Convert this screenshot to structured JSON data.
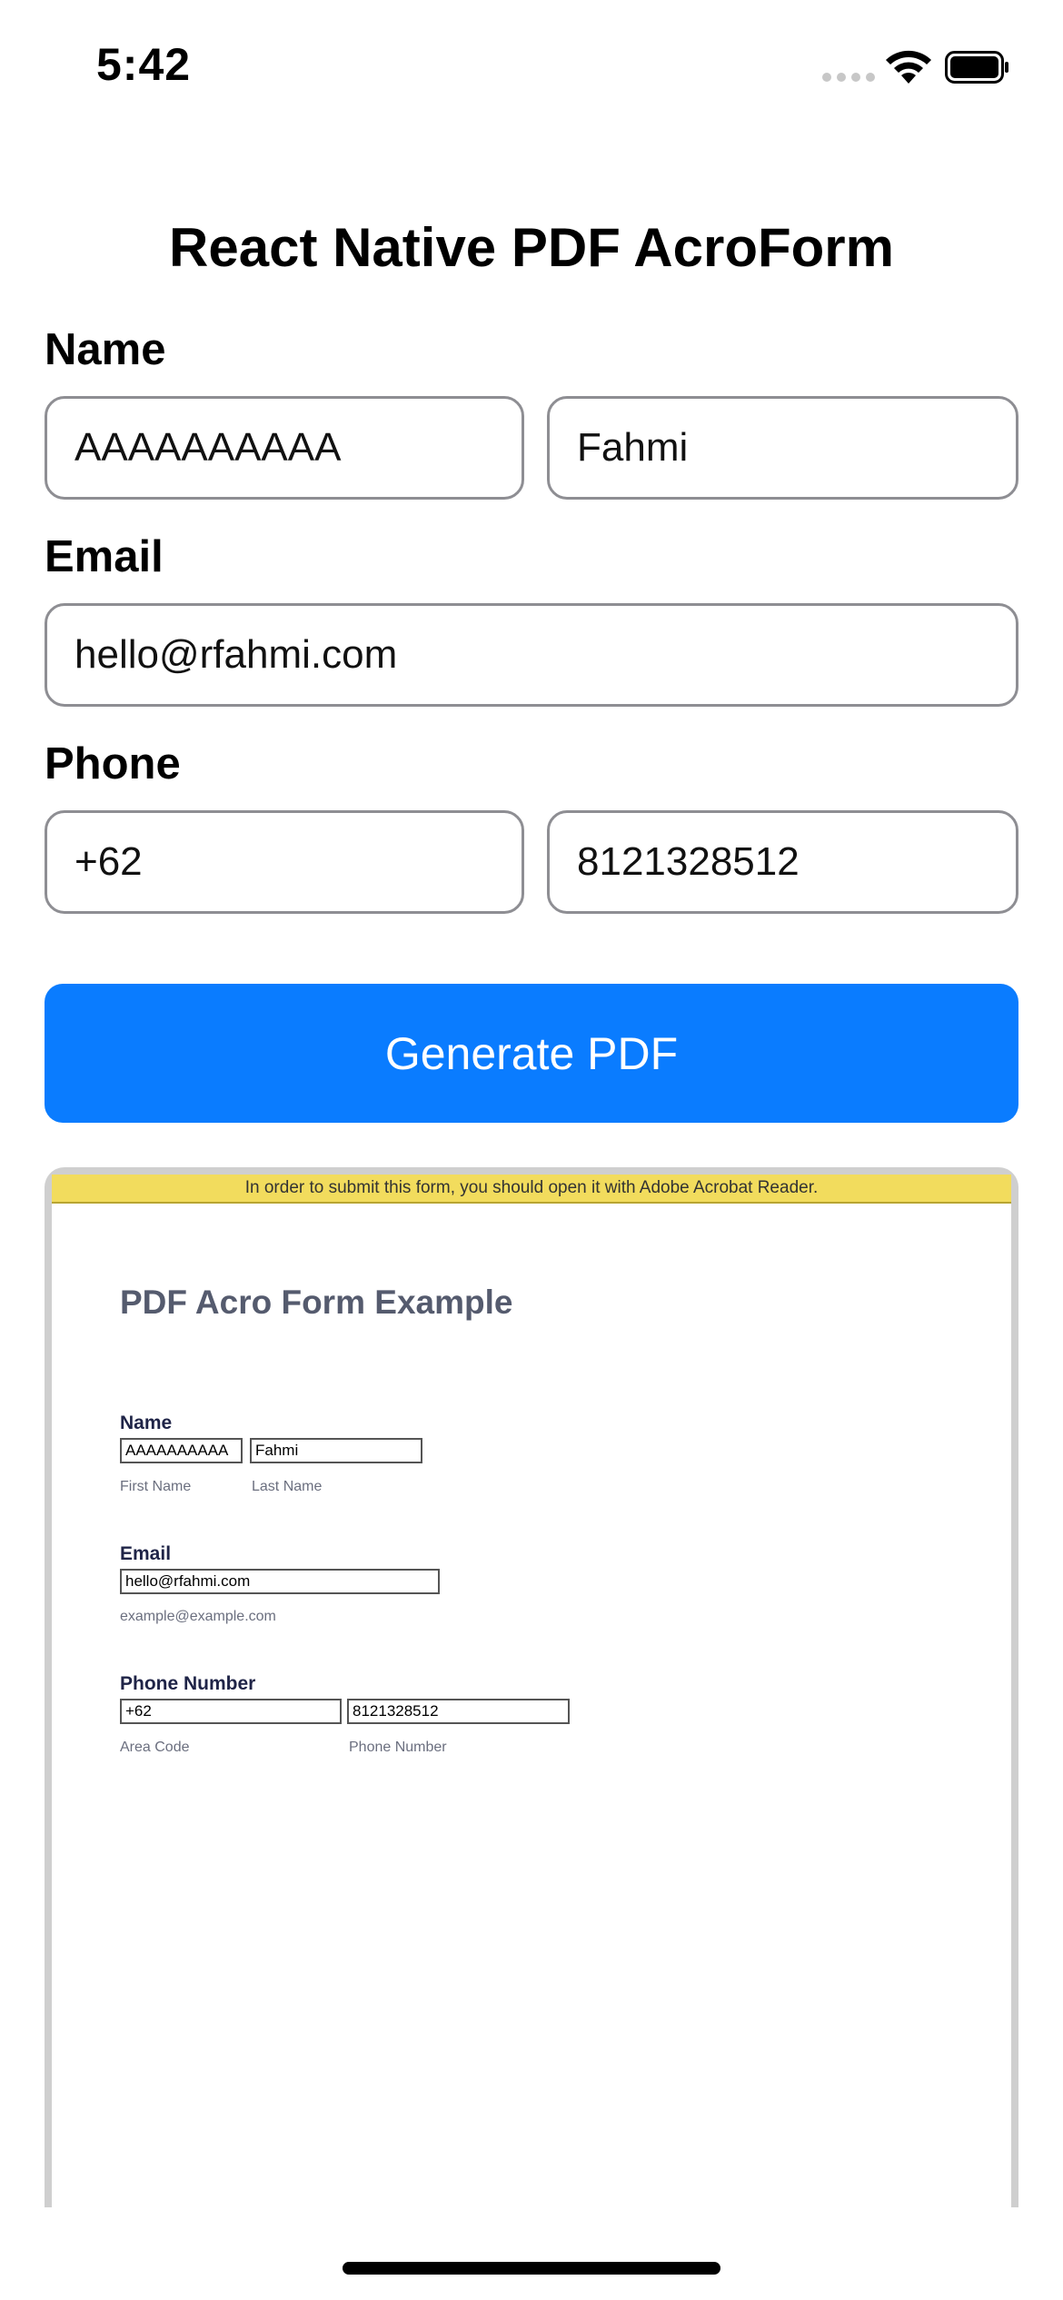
{
  "status_bar": {
    "time": "5:42"
  },
  "app": {
    "title": "React Native PDF AcroForm"
  },
  "form": {
    "name_label": "Name",
    "first_name": "AAAAAAAAAA",
    "last_name": "Fahmi",
    "email_label": "Email",
    "email": "hello@rfahmi.com",
    "phone_label": "Phone",
    "area_code": "+62",
    "phone_number": "8121328512",
    "generate_label": "Generate PDF"
  },
  "pdf": {
    "banner": "In order to submit this form, you should open it with Adobe Acrobat Reader.",
    "title": "PDF Acro Form Example",
    "name_label": "Name",
    "first_name": "AAAAAAAAAA",
    "last_name": "Fahmi",
    "first_name_hint": "First Name",
    "last_name_hint": "Last Name",
    "email_label": "Email",
    "email": "hello@rfahmi.com",
    "email_hint": "example@example.com",
    "phone_label": "Phone Number",
    "area_code": "+62",
    "phone_number": "8121328512",
    "area_code_hint": "Area Code",
    "phone_number_hint": "Phone Number"
  },
  "colors": {
    "accent": "#0a7cff",
    "banner": "#f2dc5d",
    "pdf_title": "#555b6e"
  }
}
